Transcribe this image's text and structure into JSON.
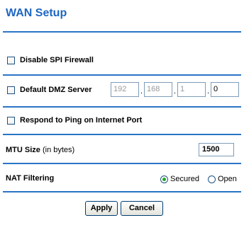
{
  "page": {
    "title": "WAN Setup"
  },
  "form": {
    "disable_spi_firewall_label": "Disable SPI Firewall",
    "default_dmz_label": "Default DMZ Server",
    "dmz_ip_octets": [
      "192",
      "168",
      "1",
      "0"
    ],
    "respond_ping_label": "Respond to Ping on Internet Port",
    "mtu_label_bold": "MTU Size",
    "mtu_label_normal": "(in bytes)",
    "mtu_value": "1500",
    "nat_label": "NAT Filtering",
    "nat_options": [
      "Secured",
      "Open"
    ],
    "nat_selected": "Secured"
  },
  "buttons": {
    "apply": "Apply",
    "cancel": "Cancel"
  },
  "colors": {
    "title": "#1e67c2",
    "rule": "#2a74c6",
    "radio_selected": "#22a622"
  }
}
